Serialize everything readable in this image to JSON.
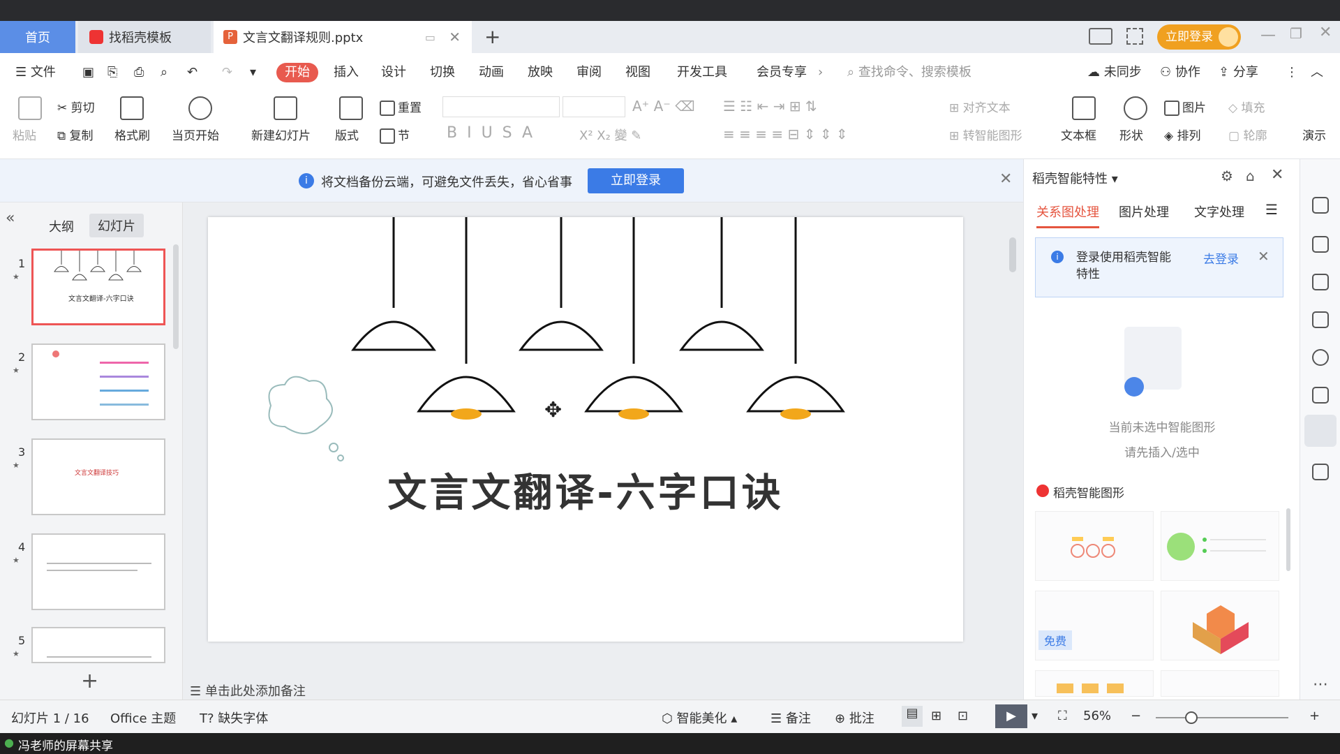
{
  "tabs": {
    "home": "首页",
    "template": "找稻壳模板",
    "document": "文言文翻译规则.pptx",
    "new_tab": "+"
  },
  "titlebar": {
    "login_button": "立即登录"
  },
  "menu": {
    "file": "文件",
    "items": [
      "开始",
      "插入",
      "设计",
      "切换",
      "动画",
      "放映",
      "审阅",
      "视图",
      "开发工具",
      "会员专享"
    ],
    "search_placeholder": "查找命令、搜索模板",
    "sync": "未同步",
    "collab": "协作",
    "share": "分享"
  },
  "ribbon": {
    "paste": "粘贴",
    "cut": "剪切",
    "copy": "复制",
    "format_painter": "格式刷",
    "play_from_current": "当页开始",
    "new_slide": "新建幻灯片",
    "layout": "版式",
    "reset": "重置",
    "section": "节",
    "align_text": "对齐文本",
    "smart_art": "转智能图形",
    "textbox": "文本框",
    "shape": "形状",
    "picture": "图片",
    "arrange": "排列",
    "fill": "填充",
    "outline": "轮廓",
    "demo": "演示"
  },
  "notice": {
    "text": "将文档备份云端，可避免文件丢失，省心省事",
    "button": "立即登录"
  },
  "left_panel": {
    "outline_tab": "大纲",
    "slides_tab": "幻灯片",
    "slides": [
      {
        "num": "1",
        "caption": "文言文翻译-六字口诀"
      },
      {
        "num": "2",
        "caption": ""
      },
      {
        "num": "3",
        "caption": "文言文翻译技巧"
      },
      {
        "num": "4",
        "caption": ""
      },
      {
        "num": "5",
        "caption": ""
      }
    ],
    "add_slide": "+"
  },
  "slide": {
    "title": "文言文翻译-六字口诀"
  },
  "notes_placeholder": "单击此处添加备注",
  "right_panel": {
    "header": "稻壳智能特性",
    "tabs": [
      "关系图处理",
      "图片处理",
      "文字处理"
    ],
    "login_tip": "登录使用稻壳智能特性",
    "login_link": "去登录",
    "empty_line1": "当前未选中智能图形",
    "empty_line2": "请先插入/选中",
    "section_title": "稻壳智能图形",
    "free_badge": "免费"
  },
  "status": {
    "slide_counter": "幻灯片 1 / 16",
    "theme": "Office 主题",
    "missing_font": "缺失字体",
    "beautify": "智能美化",
    "notes": "备注",
    "comment": "批注",
    "zoom": "56%"
  },
  "share_bar": {
    "text": "冯老师的屏幕共享"
  },
  "colors": {
    "accent_red": "#e85a4f",
    "brand_blue": "#3b7be6",
    "login_orange": "#f0a020"
  }
}
